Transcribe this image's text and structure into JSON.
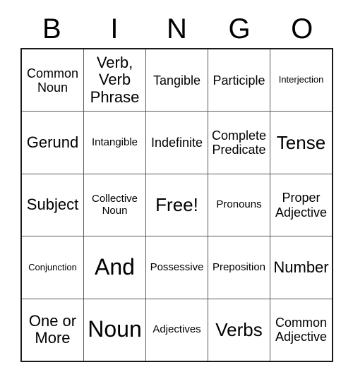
{
  "header": {
    "letters": [
      "B",
      "I",
      "N",
      "G",
      "O"
    ]
  },
  "grid": {
    "rows": [
      {
        "cells": [
          {
            "text": "Common\nNoun",
            "size": "fs-md"
          },
          {
            "text": "Verb,\nVerb\nPhrase",
            "size": "fs-lg"
          },
          {
            "text": "Tangible",
            "size": "fs-md"
          },
          {
            "text": "Participle",
            "size": "fs-md"
          },
          {
            "text": "Interjection",
            "size": "fs-xs"
          }
        ]
      },
      {
        "cells": [
          {
            "text": "Gerund",
            "size": "fs-lg"
          },
          {
            "text": "Intangible",
            "size": "fs-sm"
          },
          {
            "text": "Indefinite",
            "size": "fs-md"
          },
          {
            "text": "Complete\nPredicate",
            "size": "fs-md"
          },
          {
            "text": "Tense",
            "size": "fs-xl"
          }
        ]
      },
      {
        "cells": [
          {
            "text": "Subject",
            "size": "fs-lg"
          },
          {
            "text": "Collective\nNoun",
            "size": "fs-sm"
          },
          {
            "text": "Free!",
            "size": "fs-xl"
          },
          {
            "text": "Pronouns",
            "size": "fs-sm"
          },
          {
            "text": "Proper\nAdjective",
            "size": "fs-md"
          }
        ]
      },
      {
        "cells": [
          {
            "text": "Conjunction",
            "size": "fs-xs"
          },
          {
            "text": "And",
            "size": "fs-xxl"
          },
          {
            "text": "Possessive",
            "size": "fs-sm"
          },
          {
            "text": "Preposition",
            "size": "fs-sm"
          },
          {
            "text": "Number",
            "size": "fs-lg"
          }
        ]
      },
      {
        "cells": [
          {
            "text": "One or\nMore",
            "size": "fs-lg"
          },
          {
            "text": "Noun",
            "size": "fs-xxl"
          },
          {
            "text": "Adjectives",
            "size": "fs-sm"
          },
          {
            "text": "Verbs",
            "size": "fs-xl"
          },
          {
            "text": "Common\nAdjective",
            "size": "fs-md"
          }
        ]
      }
    ]
  },
  "colors": {
    "outer_border": "#1a1a1a",
    "inner_border": "#5a5a5a",
    "background": "#ffffff",
    "text": "#000000"
  }
}
